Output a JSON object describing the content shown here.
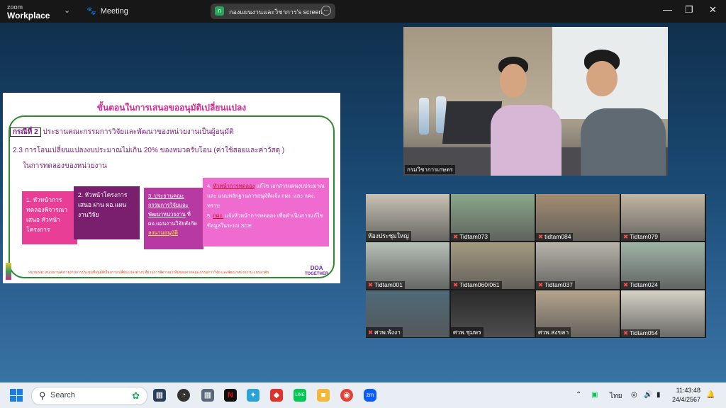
{
  "titlebar": {
    "logo_top": "zoom",
    "logo_bottom": "Workplace",
    "meeting_label": "Meeting",
    "share_badge": "ก",
    "share_text": "กองแผนงานและวิชาการ's screen"
  },
  "slide": {
    "title": "ขั้นตอนในการเสนอขออนุมัติเปลี่ยนแปลง",
    "case_label": "กรณีที่ 2",
    "case_text": "ประธานคณะกรรมการวิจัยและพัฒนาของหน่วยงานเป็นผู้อนุมัติ",
    "line_23": "2.3 การโอนเปลี่ยนแปลงงบประมาณไม่เกิน 20% ของหมวดรับโอน (ค่าใช้สอยและค่าวัสดุ )",
    "line_23b": "ในการทดลองของหน่วยงาน",
    "step1": "1. หัวหน้าการทดลองพิจารณาเสนอ หัวหน้าโครงการ",
    "step2": "2. หัวหน้าโครงการเสนอ ผ่าน ผอ.แผนงานวิจัย",
    "step3_a": "3. ประธานคณะกรรมการวิจัยและพัฒนาหน่วยงาน",
    "step3_b": "ที่ ผอ.แผนงานวิจัยสังกัด",
    "step3_c": "ลงนามอนุมัติ",
    "step4_a": "4.",
    "step4_b": "หัวหน้าการทดลอง",
    "step4_c": "แก้ไข เอกสารแผนงบประมาณ และ แนบหลักฐานการอนุมัติแจ้ง กผง. และ กคง. ทราบ",
    "step5_a": "5.",
    "step5_b": "กผง.",
    "step5_c": "แจ้งหัวหน้าการทดลอง เพื่อดำเนินการแก้ไขข้อมูลในระบบ SCE",
    "footnote": "หมายเหตุ: หน่วยงานส่งรายงานการประชุมที่อนุมัติเรื่องการเปลี่ยนแปลงต่างๆ ที่ผ่านการพิจารณาเห็นชอบจากคณะกรรมการวิจัย และพัฒนาหน่วยงาน แบบอาศัย",
    "brand_top": "DOA",
    "brand_bottom": "TOGETHER"
  },
  "main_video": {
    "label": "กรมวิชาการเกษตร"
  },
  "gallery": [
    {
      "name": "ห้องประชุมใหญ่",
      "muted": false,
      "bg": "#c9c2b3"
    },
    {
      "name": "Tidtam073",
      "muted": true,
      "bg": "#8aa78a"
    },
    {
      "name": "tidtam084",
      "muted": true,
      "bg": "#a38d71"
    },
    {
      "name": "Tidtam079",
      "muted": true,
      "bg": "#c2b6a4"
    },
    {
      "name": "Tidtam001",
      "muted": true,
      "bg": "#b7c0b7"
    },
    {
      "name": "Tidtam060/061",
      "muted": true,
      "bg": "#a59a80"
    },
    {
      "name": "Tidtam037",
      "muted": true,
      "bg": "#b8b4aa"
    },
    {
      "name": "Tidtam024",
      "muted": true,
      "bg": "#9fb3a6"
    },
    {
      "name": "ศวพ.พังงา",
      "muted": true,
      "bg": "#4f6a78"
    },
    {
      "name": "ศวพ.ชุมพร",
      "muted": false,
      "bg": "#2a2a2a"
    },
    {
      "name": "ศวพ.สงขลา",
      "muted": false,
      "bg": "#b5a48c"
    },
    {
      "name": "Tidtam054",
      "muted": true,
      "bg": "#d6d2c6"
    }
  ],
  "taskbar": {
    "search_placeholder": "Search",
    "lang": "ไทย",
    "time": "11:43:48",
    "date": "24/4/2567"
  },
  "colors": {
    "titlebar": "#171717",
    "accent_pink": "#d12a8e",
    "accent_purple": "#7a1a7a"
  }
}
